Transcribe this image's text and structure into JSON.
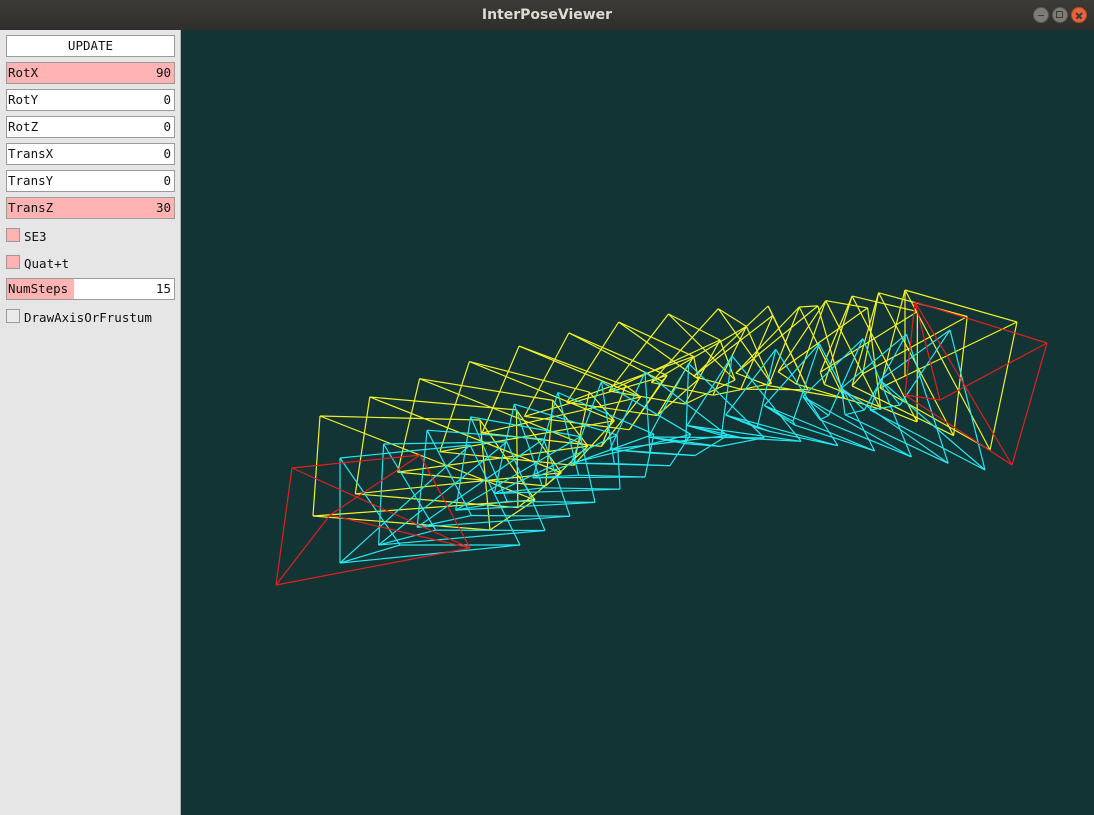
{
  "window": {
    "title": "InterPoseViewer",
    "controls": [
      "minimize",
      "maximize",
      "close"
    ]
  },
  "panel": {
    "update_label": "UPDATE",
    "sliders": [
      {
        "label": "RotX",
        "value": "90",
        "fill_fraction": 1.0
      },
      {
        "label": "RotY",
        "value": "0",
        "fill_fraction": 0.0
      },
      {
        "label": "RotZ",
        "value": "0",
        "fill_fraction": 0.0
      },
      {
        "label": "TransX",
        "value": "0",
        "fill_fraction": 0.0
      },
      {
        "label": "TransY",
        "value": "0",
        "fill_fraction": 0.0
      },
      {
        "label": "TransZ",
        "value": "30",
        "fill_fraction": 1.0
      },
      {
        "label": "NumSteps",
        "value": "15",
        "fill_fraction": 0.4
      }
    ],
    "checkboxes": [
      {
        "label": "SE3",
        "checked": true
      },
      {
        "label": "Quat+t",
        "checked": true
      },
      {
        "label": "DrawAxisOrFrustum",
        "checked": false
      }
    ]
  },
  "viewport": {
    "background_color": "#123434",
    "colors": {
      "endpoint_frustum": "#e02020",
      "se3_frustums": "#f2f22a",
      "quat_t_frustums": "#28e6f0"
    },
    "frustum_count_per_method": 15
  },
  "colors": {
    "slider_fill": "#ffb3b3",
    "checkbox_checked": "#ffb3b3",
    "panel_bg": "#e6e6e6"
  }
}
